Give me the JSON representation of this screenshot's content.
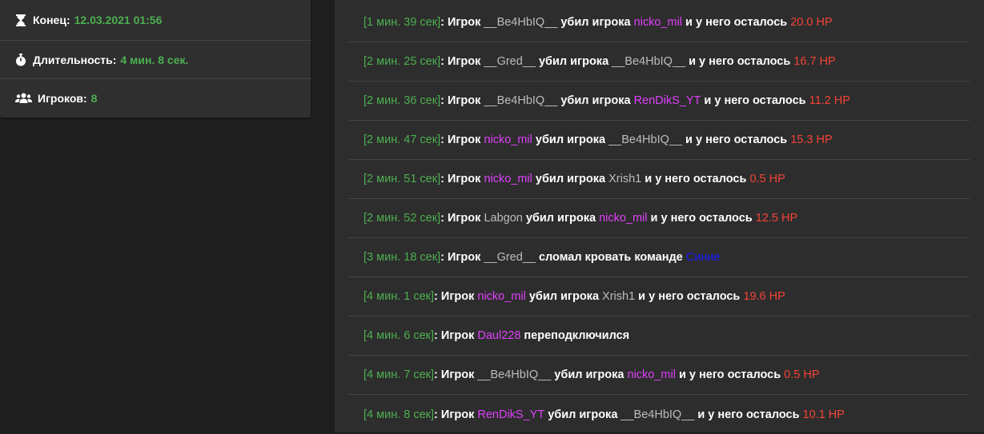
{
  "info": {
    "end_label": "Конец:",
    "end_value": "12.03.2021 01:56",
    "duration_label": "Длительность:",
    "duration_value": "4 мин. 8 сек.",
    "players_label": "Игроков:",
    "players_value": "8"
  },
  "colors": {
    "time": "#4caf50",
    "highlight_player": "#e040fb",
    "neutral_player": "#bdbdbd",
    "hp": "#f44336",
    "team_blue": "#1a1aff"
  },
  "log": [
    {
      "time": "[1 мин. 39 сек]",
      "parts": [
        {
          "text": ": Игрок ",
          "style": "bold"
        },
        {
          "text": "__Be4HbIQ__",
          "style": "gray"
        },
        {
          "text": " убил игрока ",
          "style": "bold"
        },
        {
          "text": "nicko_mil",
          "style": "pink"
        },
        {
          "text": " и у него осталось ",
          "style": "bold"
        },
        {
          "text": "20.0 HP",
          "style": "red"
        }
      ]
    },
    {
      "time": "[2 мин. 25 сек]",
      "parts": [
        {
          "text": ": Игрок ",
          "style": "bold"
        },
        {
          "text": "__Gred__",
          "style": "gray"
        },
        {
          "text": " убил игрока ",
          "style": "bold"
        },
        {
          "text": "__Be4HbIQ__",
          "style": "gray"
        },
        {
          "text": " и у него осталось ",
          "style": "bold"
        },
        {
          "text": "16.7 HP",
          "style": "red"
        }
      ]
    },
    {
      "time": "[2 мин. 36 сек]",
      "parts": [
        {
          "text": ": Игрок ",
          "style": "bold"
        },
        {
          "text": "__Be4HbIQ__",
          "style": "gray"
        },
        {
          "text": " убил игрока ",
          "style": "bold"
        },
        {
          "text": "RenDikS_YT",
          "style": "pink"
        },
        {
          "text": " и у него осталось ",
          "style": "bold"
        },
        {
          "text": "11.2 HP",
          "style": "red"
        }
      ]
    },
    {
      "time": "[2 мин. 47 сек]",
      "parts": [
        {
          "text": ": Игрок ",
          "style": "bold"
        },
        {
          "text": "nicko_mil",
          "style": "pink"
        },
        {
          "text": " убил игрока ",
          "style": "bold"
        },
        {
          "text": "__Be4HbIQ__",
          "style": "gray"
        },
        {
          "text": " и у него осталось ",
          "style": "bold"
        },
        {
          "text": "15.3 HP",
          "style": "red"
        }
      ]
    },
    {
      "time": "[2 мин. 51 сек]",
      "parts": [
        {
          "text": ": Игрок ",
          "style": "bold"
        },
        {
          "text": "nicko_mil",
          "style": "pink"
        },
        {
          "text": " убил игрока ",
          "style": "bold"
        },
        {
          "text": "Xrish1",
          "style": "gray"
        },
        {
          "text": " и у него осталось ",
          "style": "bold"
        },
        {
          "text": "0.5 HP",
          "style": "red"
        }
      ]
    },
    {
      "time": "[2 мин. 52 сек]",
      "parts": [
        {
          "text": ": Игрок ",
          "style": "bold"
        },
        {
          "text": "Labgon",
          "style": "gray"
        },
        {
          "text": " убил игрока ",
          "style": "bold"
        },
        {
          "text": "nicko_mil",
          "style": "pink"
        },
        {
          "text": " и у него осталось ",
          "style": "bold"
        },
        {
          "text": "12.5 HP",
          "style": "red"
        }
      ]
    },
    {
      "time": "[3 мин. 18 сек]",
      "parts": [
        {
          "text": ": Игрок ",
          "style": "bold"
        },
        {
          "text": "__Gred__",
          "style": "gray"
        },
        {
          "text": " сломал кровать команде ",
          "style": "bold"
        },
        {
          "text": "Синие",
          "style": "blue"
        }
      ]
    },
    {
      "time": "[4 мин. 1 сек]",
      "parts": [
        {
          "text": ": Игрок ",
          "style": "bold"
        },
        {
          "text": "nicko_mil",
          "style": "pink"
        },
        {
          "text": " убил игрока ",
          "style": "bold"
        },
        {
          "text": "Xrish1",
          "style": "gray"
        },
        {
          "text": " и у него осталось ",
          "style": "bold"
        },
        {
          "text": "19.6 HP",
          "style": "red"
        }
      ]
    },
    {
      "time": "[4 мин. 6 сек]",
      "parts": [
        {
          "text": ": Игрок ",
          "style": "bold"
        },
        {
          "text": "Daul228",
          "style": "pink"
        },
        {
          "text": " переподключился",
          "style": "bold"
        }
      ]
    },
    {
      "time": "[4 мин. 7 сек]",
      "parts": [
        {
          "text": ": Игрок ",
          "style": "bold"
        },
        {
          "text": "__Be4HbIQ__",
          "style": "gray"
        },
        {
          "text": " убил игрока ",
          "style": "bold"
        },
        {
          "text": "nicko_mil",
          "style": "pink"
        },
        {
          "text": " и у него осталось ",
          "style": "bold"
        },
        {
          "text": "0.5 HP",
          "style": "red"
        }
      ]
    },
    {
      "time": "[4 мин. 8 сек]",
      "parts": [
        {
          "text": ": Игрок ",
          "style": "bold"
        },
        {
          "text": "RenDikS_YT",
          "style": "pink"
        },
        {
          "text": " убил игрока ",
          "style": "bold"
        },
        {
          "text": "__Be4HbIQ__",
          "style": "gray"
        },
        {
          "text": " и у него осталось ",
          "style": "bold"
        },
        {
          "text": "10.1 HP",
          "style": "red"
        }
      ]
    }
  ]
}
